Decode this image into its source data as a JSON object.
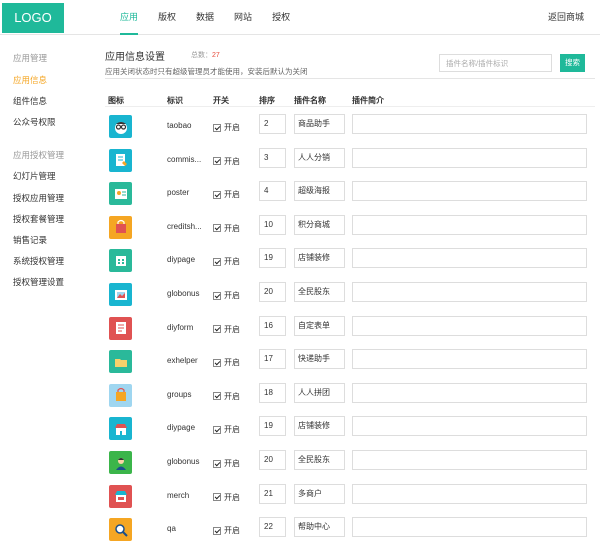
{
  "header": {
    "logo": "LOGO",
    "nav": [
      "应用",
      "版权",
      "数据",
      "网站",
      "授权"
    ],
    "back_link": "返回商城"
  },
  "sidebar": {
    "groups": [
      {
        "title": "应用管理",
        "items": [
          "应用信息",
          "组件信息",
          "公众号权限"
        ]
      },
      {
        "title": "应用授权管理",
        "items": [
          "幻灯片管理",
          "授权应用管理",
          "授权套餐管理",
          "销售记录",
          "系统授权管理",
          "授权管理设置"
        ]
      }
    ],
    "active_item": "应用信息"
  },
  "main": {
    "title": "应用信息设置",
    "count_prefix": "总数：",
    "count": "27",
    "subtitle": "应用关闭状态时只有超级管理员才能使用，安装后默认为关闭",
    "search_placeholder": "插件名称/插件标识",
    "search_button": "搜索",
    "columns": [
      "图标",
      "标识",
      "开关",
      "排序",
      "插件名称",
      "插件简介"
    ]
  },
  "rows": [
    {
      "icon": "glasses-face-icon",
      "color": "#19b5d0",
      "mark": "taobao",
      "switch": "开启",
      "sort": "2",
      "name": "商品助手"
    },
    {
      "icon": "document-pen-icon",
      "color": "#19b5d0",
      "mark": "commis...",
      "switch": "开启",
      "sort": "3",
      "name": "人人分销"
    },
    {
      "icon": "poster-icon",
      "color": "#2ab99a",
      "mark": "poster",
      "switch": "开启",
      "sort": "4",
      "name": "超级海报"
    },
    {
      "icon": "shopping-bag-icon",
      "color": "#f5a623",
      "mark": "creditsh...",
      "switch": "开启",
      "sort": "10",
      "name": "积分商城"
    },
    {
      "icon": "calendar-grid-icon",
      "color": "#2ab99a",
      "mark": "diypage",
      "switch": "开启",
      "sort": "19",
      "name": "店铺装修"
    },
    {
      "icon": "photo-frame-icon",
      "color": "#19b5d0",
      "mark": "globonus",
      "switch": "开启",
      "sort": "20",
      "name": "全民股东"
    },
    {
      "icon": "form-list-icon",
      "color": "#e05252",
      "mark": "diyform",
      "switch": "开启",
      "sort": "16",
      "name": "自定表单"
    },
    {
      "icon": "folder-icon",
      "color": "#2ab99a",
      "mark": "exhelper",
      "switch": "开启",
      "sort": "17",
      "name": "快递助手"
    },
    {
      "icon": "group-bag-icon",
      "color": "#9fd6f0",
      "mark": "groups",
      "switch": "开启",
      "sort": "18",
      "name": "人人拼团"
    },
    {
      "icon": "storefront-icon",
      "color": "#19b5d0",
      "mark": "diypage",
      "switch": "开启",
      "sort": "19",
      "name": "店铺装修"
    },
    {
      "icon": "person-icon",
      "color": "#3bb54a",
      "mark": "globonus",
      "switch": "开启",
      "sort": "20",
      "name": "全民股东"
    },
    {
      "icon": "merchant-store-icon",
      "color": "#e05252",
      "mark": "merch",
      "switch": "开启",
      "sort": "21",
      "name": "多商户"
    },
    {
      "icon": "magnifier-icon",
      "color": "#f5a623",
      "mark": "qa",
      "switch": "开启",
      "sort": "22",
      "name": "帮助中心"
    }
  ]
}
